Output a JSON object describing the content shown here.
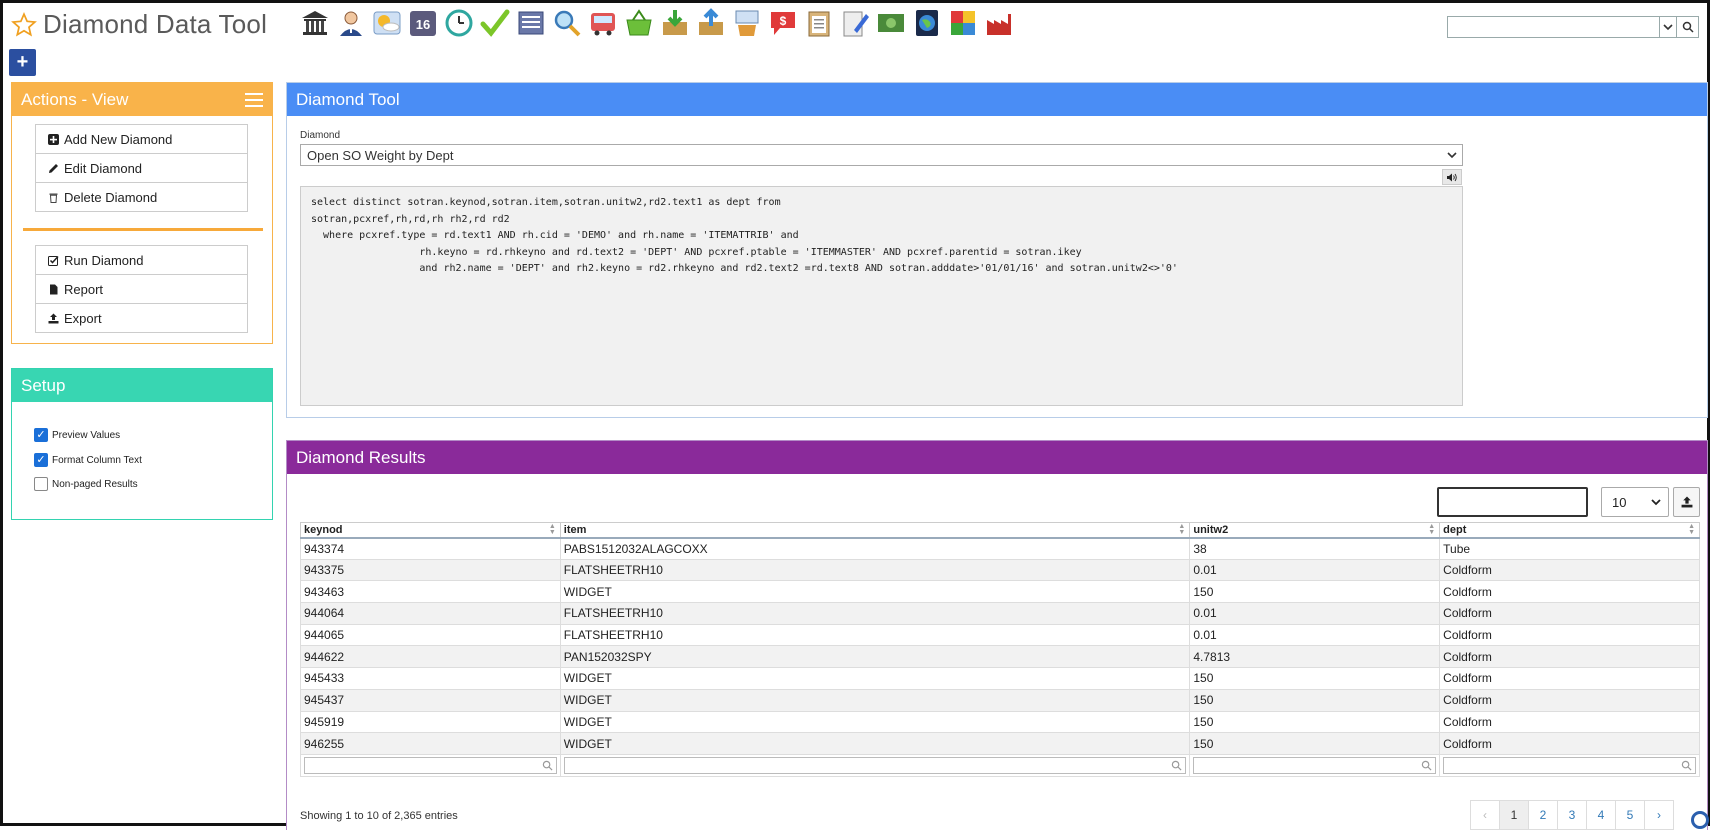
{
  "app": {
    "title": "Diamond Data Tool"
  },
  "toolbar": {
    "icons": [
      "bank-icon",
      "user-icon",
      "weather-icon",
      "calendar-icon",
      "clock-icon",
      "checkmark-icon",
      "document-list-icon",
      "magnifier-icon",
      "bus-icon",
      "basket-icon",
      "download-box-icon",
      "upload-box-icon",
      "tools-icon",
      "speech-dollar-icon",
      "clipboard-icon",
      "notepad-pencil-icon",
      "money-icon",
      "globe-icon",
      "refresh-arrows-icon",
      "factory-icon"
    ],
    "calendar_number": "16"
  },
  "global_search": {
    "value": ""
  },
  "actions_panel": {
    "title": "Actions - View",
    "group1": [
      "Add New Diamond",
      "Edit Diamond",
      "Delete Diamond"
    ],
    "group2": [
      "Run Diamond",
      "Report",
      "Export"
    ]
  },
  "setup_panel": {
    "title": "Setup",
    "options": [
      {
        "label": "Preview Values",
        "checked": true
      },
      {
        "label": "Format Column Text",
        "checked": true
      },
      {
        "label": "Non-paged Results",
        "checked": false
      }
    ]
  },
  "tool_panel": {
    "title": "Diamond Tool",
    "field_label": "Diamond",
    "selected": "Open SO Weight by Dept",
    "sql": "select distinct sotran.keynod,sotran.item,sotran.unitw2,rd2.text1 as dept from\nsotran,pcxref,rh,rd,rh rh2,rd rd2\n  where pcxref.type = rd.text1 AND rh.cid = 'DEMO' and rh.name = 'ITEMATTRIB' and\n                  rh.keyno = rd.rhkeyno and rd.text2 = 'DEPT' AND pcxref.ptable = 'ITEMMASTER' AND pcxref.parentid = sotran.ikey\n                  and rh2.name = 'DEPT' and rh2.keyno = rd2.rhkeyno and rd2.text2 =rd.text8 AND sotran.adddate>'01/01/16' and sotran.unitw2<>'0'"
  },
  "results_panel": {
    "title": "Diamond Results",
    "search_value": "",
    "page_size": "10",
    "columns": [
      "keynod",
      "item",
      "unitw2",
      "dept"
    ],
    "rows": [
      [
        "943374",
        "PABS1512032ALAGCOXX",
        "38",
        "Tube"
      ],
      [
        "943375",
        "FLATSHEETRH10",
        "0.01",
        "Coldform"
      ],
      [
        "943463",
        "WIDGET",
        "150",
        "Coldform"
      ],
      [
        "944064",
        "FLATSHEETRH10",
        "0.01",
        "Coldform"
      ],
      [
        "944065",
        "FLATSHEETRH10",
        "0.01",
        "Coldform"
      ],
      [
        "944622",
        "PAN152032SPY",
        "4.7813",
        "Coldform"
      ],
      [
        "945433",
        "WIDGET",
        "150",
        "Coldform"
      ],
      [
        "945437",
        "WIDGET",
        "150",
        "Coldform"
      ],
      [
        "945919",
        "WIDGET",
        "150",
        "Coldform"
      ],
      [
        "946255",
        "WIDGET",
        "150",
        "Coldform"
      ]
    ],
    "showing": "Showing 1 to 10 of 2,365 entries",
    "pager": {
      "prev": "‹",
      "pages": [
        "1",
        "2",
        "3",
        "4",
        "5"
      ],
      "next": "›"
    }
  }
}
